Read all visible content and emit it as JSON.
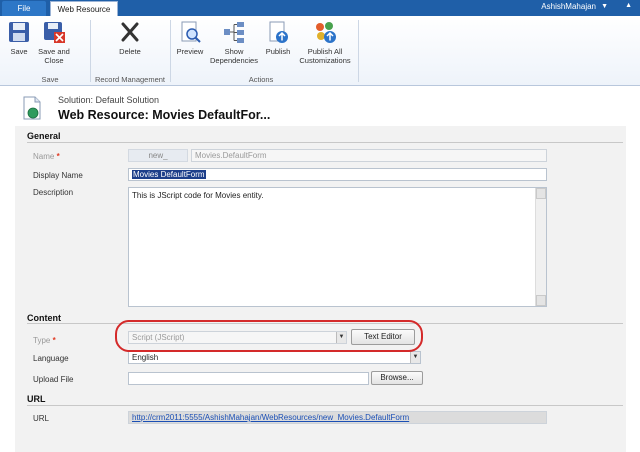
{
  "topbar": {
    "file_tab": "File",
    "active_tab": "Web Resource",
    "user": "AshishMahajan"
  },
  "ribbon": {
    "save": "Save",
    "save_close_l1": "Save and",
    "save_close_l2": "Close",
    "delete": "Delete",
    "preview": "Preview",
    "show_dep_l1": "Show",
    "show_dep_l2": "Dependencies",
    "publish": "Publish",
    "publish_all_l1": "Publish All",
    "publish_all_l2": "Customizations",
    "groups": {
      "save": "Save",
      "record_mgmt": "Record Management",
      "actions": "Actions"
    }
  },
  "header": {
    "solution": "Solution: Default Solution",
    "title": "Web Resource: Movies DefaultFor..."
  },
  "general": {
    "section": "General",
    "name_label": "Name",
    "name_prefix": "new_",
    "name_value": "Movies.DefaultForm",
    "display_label": "Display Name",
    "display_value": "Movies DefaultForm",
    "desc_label": "Description",
    "desc_value": "This is JScript code for Movies entity."
  },
  "content": {
    "section": "Content",
    "type_label": "Type",
    "type_value": "Script (JScript)",
    "text_editor": "Text Editor",
    "language_label": "Language",
    "language_value": "English",
    "upload_label": "Upload File",
    "browse": "Browse..."
  },
  "url": {
    "section": "URL",
    "url_label": "URL",
    "url_value": "http://crm2011:5555/AshishMahajan/WebResources/new_Movies.DefaultForm"
  },
  "colors": {
    "topbar": "#1f5fa8",
    "required": "#e03b24",
    "highlight": "#d42a2a",
    "selection": "#1d3f8a",
    "link": "#1b4fb5"
  }
}
